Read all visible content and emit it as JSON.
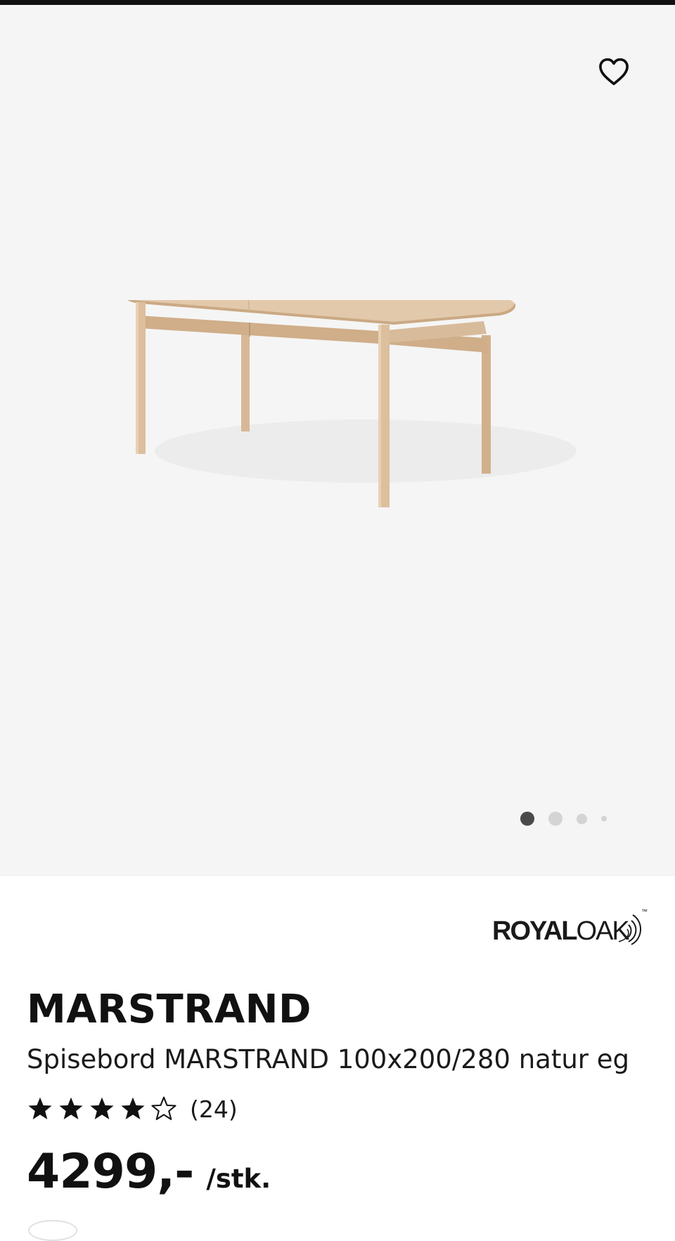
{
  "gallery": {
    "favorite_icon": "heart-outline-icon",
    "image_alt": "Spisebord MARSTRAND 100x200/280 natur eg",
    "dots_count": 4,
    "active_dot": 1
  },
  "brand": {
    "logo_text_bold": "ROYAL",
    "logo_text_light": "OAK",
    "trademark": "™"
  },
  "product": {
    "name": "MARSTRAND",
    "description": "Spisebord MARSTRAND 100x200/280 natur eg",
    "rating": 4.5,
    "rating_max": 5,
    "review_count": "(24)",
    "price": "4299,-",
    "price_unit": "/stk."
  },
  "colors": {
    "gallery_bg": "#f5f5f5",
    "text": "#111111",
    "dot_active": "#4a4a4a",
    "dot_inactive": "#d4d4d4",
    "wood": "#dfc3a3"
  }
}
